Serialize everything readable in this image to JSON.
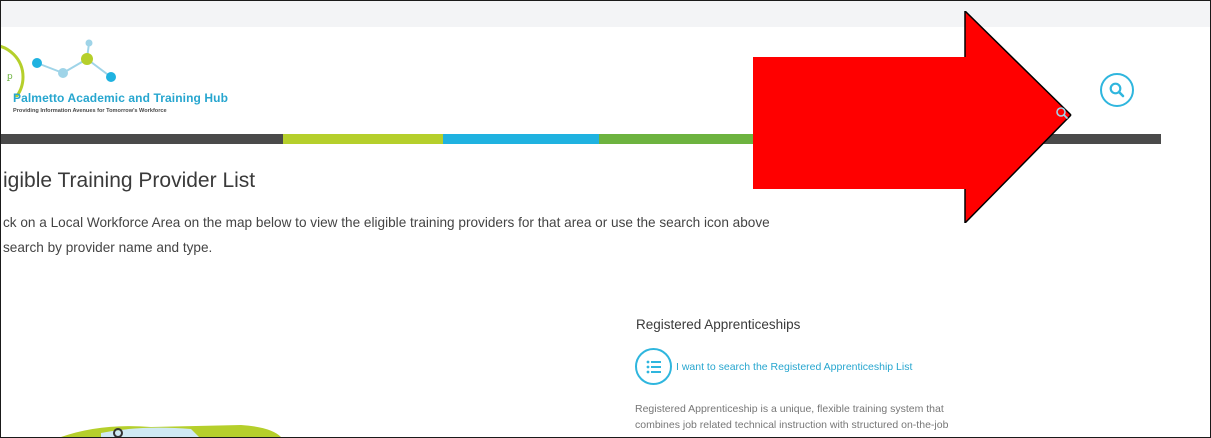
{
  "header": {
    "logo_title": "Palmetto Academic and Training Hub",
    "logo_tagline": "Providing Information Avenues for Tomorrow's Workforce",
    "search_icon": "search-icon"
  },
  "colors": {
    "accent_blue": "#2fb6de",
    "bar_dark": "#4a4a4a",
    "bar_lime": "#b5cf2b",
    "bar_blue": "#1fb2e0",
    "bar_green": "#6db33f",
    "annotation_red": "#ff0000"
  },
  "main": {
    "title": "igible Training Provider List",
    "intro_line1": "ck on a Local Workforce Area on the map below to view the eligible training providers for that area or use the search icon above",
    "intro_line2": "search by provider name and type."
  },
  "apprenticeships": {
    "heading": "Registered Apprenticeships",
    "icon": "list-icon",
    "link": "I want to search the Registered Apprenticeship List",
    "description_line1": "Registered Apprenticeship is a unique, flexible training system that",
    "description_line2": "combines job related technical instruction with structured on-the-job"
  },
  "annotation": {
    "icon": "red-arrow-right"
  }
}
